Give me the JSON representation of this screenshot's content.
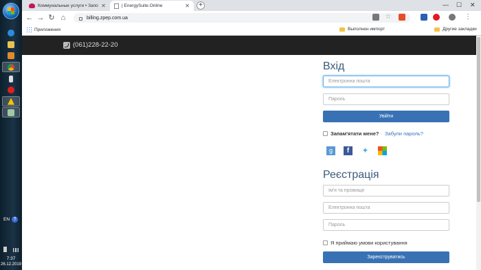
{
  "taskbar": {
    "lang": "EN",
    "help": "?",
    "time": "7:37",
    "date": "26.12.2019"
  },
  "browser": {
    "tabs": [
      {
        "title": "Коммунальные услуги • Запорож",
        "icon": "heart-icon"
      },
      {
        "title": "| EnergySuite.Online",
        "icon": "page-icon"
      }
    ],
    "new_tab": "+",
    "url": "billing.zpep.com.ua",
    "window_controls": {
      "minimize": "—",
      "maximize": "☐",
      "close": "✕"
    }
  },
  "bookmarks": {
    "apps": "Приложения",
    "items": [
      "Выполнен импорт"
    ],
    "other": "Другие закладки"
  },
  "site": {
    "phone": "(061)228-22-20",
    "login": {
      "title": "Вхід",
      "email_placeholder": "Електронна пошта",
      "password_placeholder": "Пароль",
      "submit": "Увійти",
      "remember": "Запам'ятати мене?",
      "separator": "·",
      "forgot": "Забули пароль?"
    },
    "social": [
      "google-plus",
      "facebook",
      "twitter",
      "microsoft"
    ],
    "register": {
      "title": "Реєстрація",
      "name_placeholder": "Ім'я та прізвище",
      "email_placeholder": "Електронна пошта",
      "password_placeholder": "Пароль",
      "terms": "Я приймаю умови користування",
      "submit": "Зареєструватись"
    }
  }
}
